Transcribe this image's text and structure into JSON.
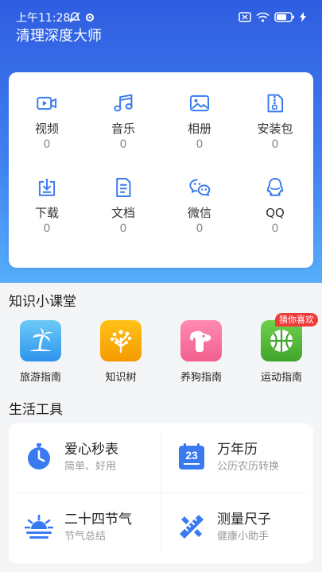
{
  "status": {
    "time": "上午11:28"
  },
  "app": {
    "title": "清理深度大师"
  },
  "files": [
    {
      "label": "视频",
      "count": "0",
      "icon": "video-icon"
    },
    {
      "label": "音乐",
      "count": "0",
      "icon": "music-icon"
    },
    {
      "label": "相册",
      "count": "0",
      "icon": "album-icon"
    },
    {
      "label": "安装包",
      "count": "0",
      "icon": "apk-package-icon"
    },
    {
      "label": "下载",
      "count": "0",
      "icon": "download-icon"
    },
    {
      "label": "文档",
      "count": "0",
      "icon": "document-icon"
    },
    {
      "label": "微信",
      "count": "0",
      "icon": "wechat-icon"
    },
    {
      "label": "QQ",
      "count": "0",
      "icon": "qq-icon"
    }
  ],
  "knowledge": {
    "title": "知识小课堂",
    "badge": "猜你喜欢",
    "items": [
      {
        "label": "旅游指南",
        "icon": "palm-tree-icon",
        "color": "#3aa5f0"
      },
      {
        "label": "知识树",
        "icon": "tree-icon",
        "color": "#f6a300"
      },
      {
        "label": "养狗指南",
        "icon": "dog-icon",
        "color": "#f76f9c"
      },
      {
        "label": "运动指南",
        "icon": "basketball-icon",
        "color": "#45b334"
      }
    ]
  },
  "tools": {
    "title": "生活工具",
    "items": [
      {
        "title": "爱心秒表",
        "subtitle": "简单、好用",
        "icon": "stopwatch-icon"
      },
      {
        "title": "万年历",
        "subtitle": "公历农历转换",
        "icon": "calendar-icon",
        "calendar_day": "23"
      },
      {
        "title": "二十四节气",
        "subtitle": "节气总结",
        "icon": "sunrise-icon"
      },
      {
        "title": "测量尺子",
        "subtitle": "健康小助手",
        "icon": "ruler-icon"
      }
    ]
  },
  "colors": {
    "accent": "#3a7af0",
    "header_top": "#2f5de0",
    "header_bottom": "#56aefb",
    "badge": "#f03b3b"
  }
}
